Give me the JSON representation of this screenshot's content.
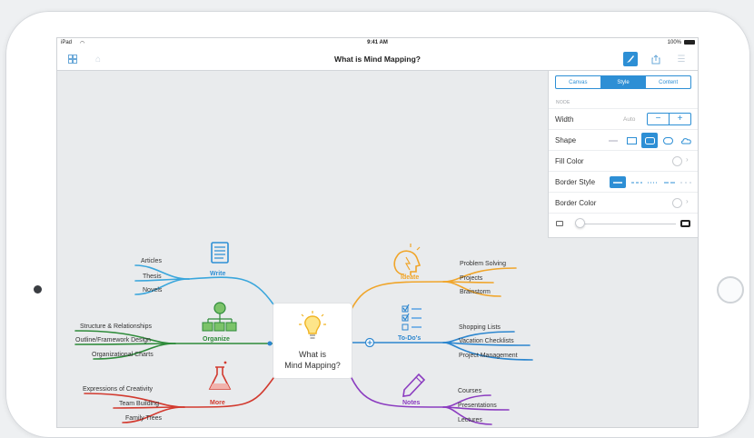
{
  "status": {
    "device": "iPad",
    "time": "9:41 AM",
    "battery": "100%"
  },
  "nav": {
    "title": "What is Mind Mapping?"
  },
  "panel": {
    "tabs": [
      {
        "label": "Canvas"
      },
      {
        "label": "Style"
      },
      {
        "label": "Content"
      }
    ],
    "section": "NODE",
    "width_label": "Width",
    "width_value": "Auto",
    "minus": "−",
    "plus": "+",
    "shape_label": "Shape",
    "fill_label": "Fill Color",
    "border_style_label": "Border Style",
    "border_color_label": "Border Color",
    "chevron": "›"
  },
  "colors": {
    "accent": "#2d8fd5",
    "write": "#3aa6dc",
    "organize": "#2e8b3a",
    "more": "#d23a2f",
    "ideate": "#f0a52a",
    "todos": "#2c86cf",
    "notes": "#8b3cc0"
  },
  "mindmap": {
    "center": {
      "line1": "What is",
      "line2": "Mind Mapping?"
    },
    "write": {
      "label": "Write",
      "items": [
        "Articles",
        "Thesis",
        "Novels"
      ]
    },
    "organize": {
      "label": "Organize",
      "items": [
        "Structure & Relationships",
        "Outline/Framework Design",
        "Organizational Charts"
      ]
    },
    "more": {
      "label": "More",
      "items": [
        "Expressions of Creativity",
        "Team Building",
        "Family Trees"
      ]
    },
    "ideate": {
      "label": "Ideate",
      "items": [
        "Problem Solving",
        "Projects",
        "Brainstorm"
      ]
    },
    "todos": {
      "label": "To-Do's",
      "items": [
        "Shopping Lists",
        "Vacation Checklists",
        "Project Management"
      ]
    },
    "notes": {
      "label": "Notes",
      "items": [
        "Courses",
        "Presentations",
        "Lectures"
      ]
    }
  }
}
